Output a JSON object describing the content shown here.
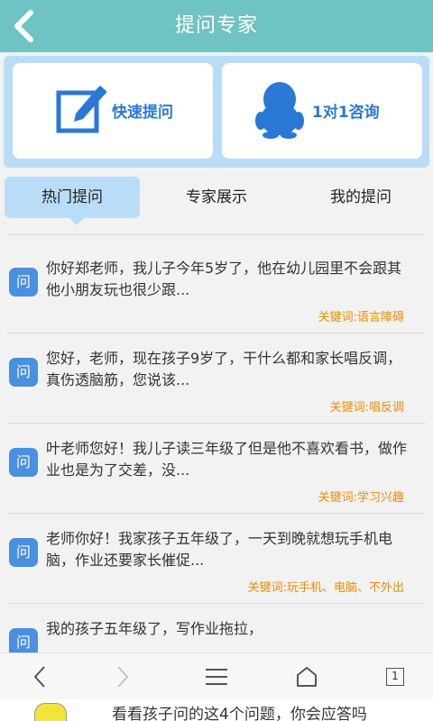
{
  "header": {
    "title": "提问专家"
  },
  "actions": {
    "quick_ask": "快速提问",
    "one_on_one": "1对1咨询"
  },
  "tabs": {
    "hot": "热门提问",
    "experts": "专家展示",
    "mine": "我的提问"
  },
  "badge_label": "问",
  "questions": [
    {
      "text": "你好郑老师，我儿子今年5岁了，他在幼儿园里不会跟其他小朋友玩也很少跟...",
      "keyword": "关键词:语言障碍"
    },
    {
      "text": "您好，老师，现在孩子9岁了，干什么都和家长唱反调，真伤透脑筋，您说该...",
      "keyword": "关键词:唱反调"
    },
    {
      "text": "叶老师您好！我儿子读三年级了但是他不喜欢看书，做作业也是为了交差，没...",
      "keyword": "关键词:学习兴趣"
    },
    {
      "text": "老师你好！我家孩子五年级了，一天到晚就想玩手机电脑，作业还要家长催促...",
      "keyword": "关键词:玩手机、电脑、不外出"
    },
    {
      "text": "我的孩子五年级了，写作业拖拉，",
      "keyword": ""
    }
  ],
  "bottom_nav": {
    "page_count": "1"
  },
  "banner": {
    "text": "看看孩子问的这4个问题，你会应答吗"
  },
  "colors": {
    "header": "#6fc3c3",
    "accent": "#2a78d6",
    "panel": "#b9ddf6",
    "keyword": "#f08a00"
  }
}
